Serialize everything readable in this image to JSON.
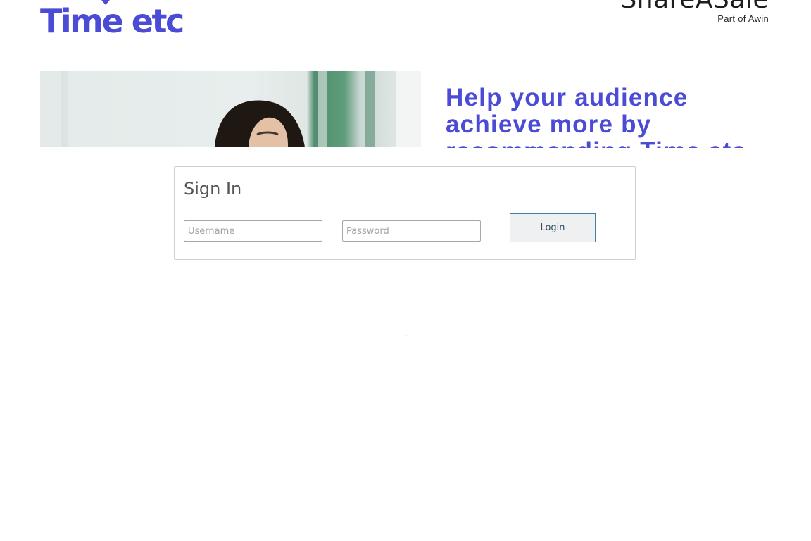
{
  "theme": {
    "brand_color": "#4b4bd6",
    "button_border": "#3f7fa0"
  },
  "header": {
    "brand_logo_text": "Time etc",
    "brand_mark_icon": "heart-chevron-icon",
    "partner_logo_text": "ShareASale",
    "partner_logo_subtext": "Part of Awin"
  },
  "hero": {
    "photo": "woman-portrait-photo",
    "heading": "Help your audience achieve more by recommending Time etc"
  },
  "signin": {
    "title": "Sign In",
    "username_placeholder": "Username",
    "username_value": "",
    "password_placeholder": "Password",
    "password_value": "",
    "login_label": "Login"
  }
}
